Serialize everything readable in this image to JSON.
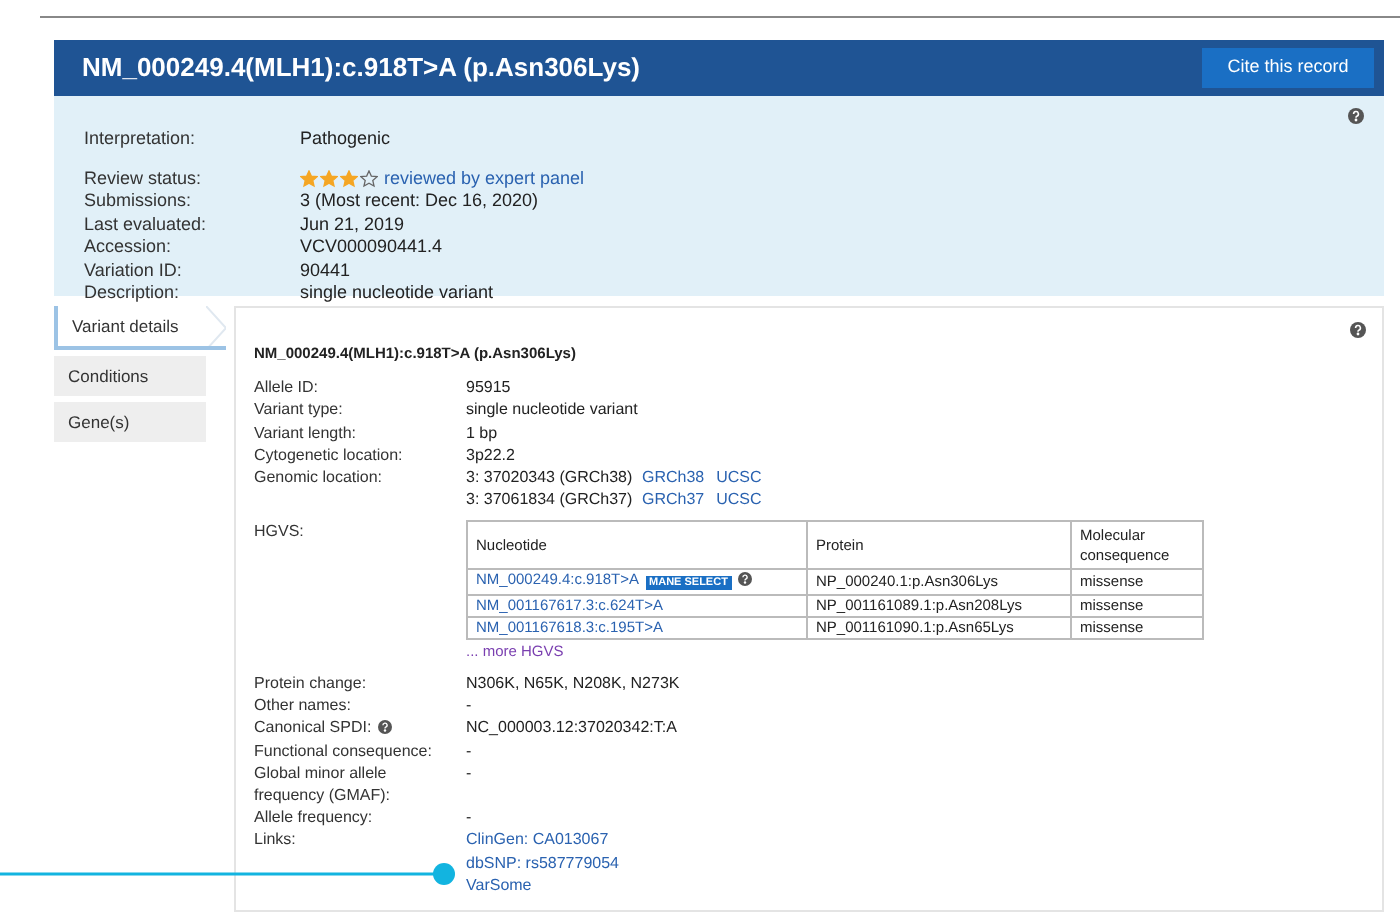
{
  "header": {
    "title": "NM_000249.4(MLH1):c.918T>A (p.Asn306Lys)",
    "button": "Cite this record"
  },
  "summary": {
    "rows": [
      {
        "label": "Interpretation:",
        "value": "Pathogenic"
      },
      {
        "label": "Review status:",
        "value": "reviewed by expert panel",
        "kind": "stars",
        "stars": 3
      },
      {
        "label": "Submissions:",
        "value": "3 (Most recent: Dec 16, 2020)"
      },
      {
        "label": "Last evaluated:",
        "value": "Jun 21, 2019"
      },
      {
        "label": "Accession:",
        "value": "VCV000090441.4"
      },
      {
        "label": "Variation ID:",
        "value": "90441"
      },
      {
        "label": "Description:",
        "value": "single nucleotide variant"
      }
    ]
  },
  "tabs": [
    {
      "label": "Variant details",
      "selected": true
    },
    {
      "label": "Conditions",
      "selected": false
    },
    {
      "label": "Gene(s)",
      "selected": false
    }
  ],
  "details": {
    "title": "NM_000249.4(MLH1):c.918T>A (p.Asn306Lys)",
    "rows": [
      {
        "label": "Allele ID:",
        "values": [
          "95915"
        ]
      },
      {
        "label": "Variant type:",
        "values": [
          "single nucleotide variant"
        ]
      },
      {
        "label": "Variant length:",
        "values": [
          "1 bp"
        ]
      },
      {
        "label": "Cytogenetic location:",
        "values": [
          "3p22.2"
        ]
      },
      {
        "label": "Genomic location:",
        "kind": "genomic",
        "values": [
          "3: 37020343 (GRCh38)",
          "3: 37061834 (GRCh37)"
        ],
        "links": [
          [
            "GRCh38",
            "UCSC"
          ],
          [
            "GRCh37",
            "UCSC"
          ]
        ]
      },
      {
        "label": "HGVS:",
        "kind": "hgvs"
      },
      {
        "label": "Protein change:",
        "values": [
          "N306K, N65K, N208K, N273K"
        ]
      },
      {
        "label": "Other names:",
        "values": [
          "-"
        ]
      },
      {
        "label": "Canonical SPDI:",
        "help": true,
        "values": [
          "NC_000003.12:37020342:T:A"
        ]
      },
      {
        "label": "Functional consequence:",
        "values": [
          "-"
        ]
      },
      {
        "label": "Global minor allele frequency (GMAF):",
        "values": [
          "-"
        ]
      },
      {
        "label": "Allele frequency:",
        "values": [
          "-"
        ]
      },
      {
        "label": "Links:",
        "kind": "links",
        "values": [
          "ClinGen: CA013067",
          "dbSNP: rs587779054",
          "VarSome"
        ]
      }
    ]
  },
  "hgvs": {
    "columns": [
      "Nucleotide",
      "Protein",
      "Molecular consequence"
    ],
    "rows": [
      {
        "nucleotide": "NM_000249.4:c.918T>A",
        "badge": "MANE SELECT",
        "protein": "NP_000240.1:p.Asn306Lys",
        "consequence": "missense"
      },
      {
        "nucleotide": "NM_001167617.3:c.624T>A",
        "protein": "NP_001161089.1:p.Asn208Lys",
        "consequence": "missense"
      },
      {
        "nucleotide": "NM_001167618.3:c.195T>A",
        "protein": "NP_001161090.1:p.Asn65Lys",
        "consequence": "missense"
      }
    ],
    "more": "... more HGVS"
  }
}
